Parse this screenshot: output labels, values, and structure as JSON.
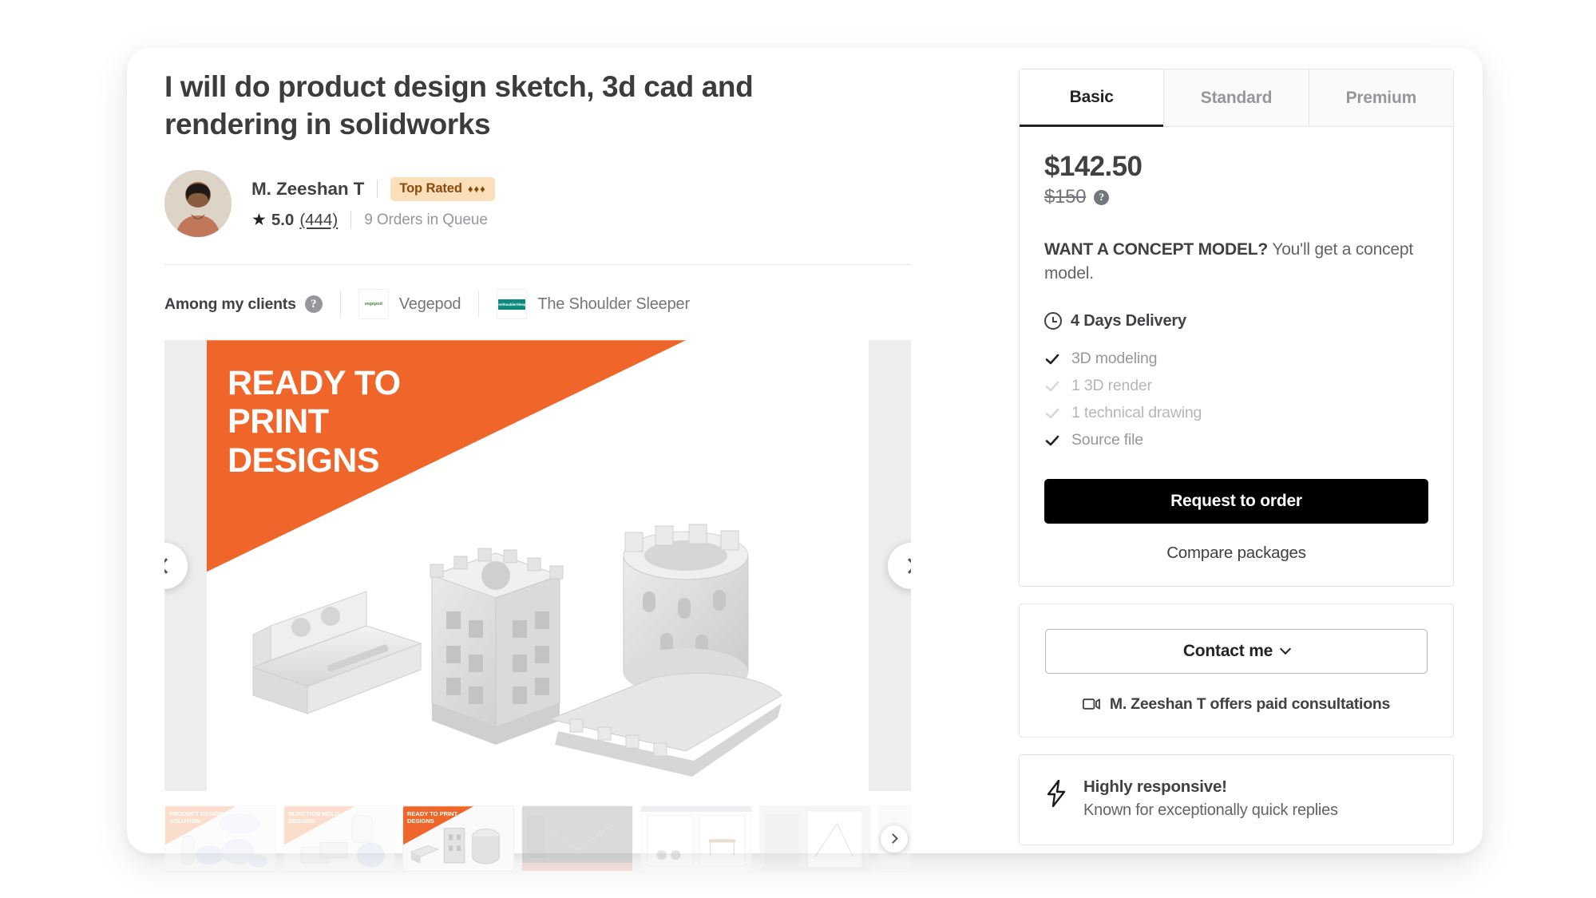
{
  "gig": {
    "title": "I will do product design sketch, 3d cad and rendering in solidworks"
  },
  "seller": {
    "name": "M. Zeeshan T",
    "badge_label": "Top Rated",
    "badge_diamonds": "♦♦♦",
    "rating_value": "5.0",
    "rating_count": "(444)",
    "queue": "9 Orders in Queue",
    "avatar_alt": "seller-avatar"
  },
  "clients": {
    "label": "Among my clients",
    "help_icon": "question-mark-icon",
    "items": [
      {
        "name": "Vegepod",
        "logo_text": "vegepod"
      },
      {
        "name": "The Shoulder Sleeper",
        "logo_text": "TheShoulderSleeper"
      }
    ]
  },
  "gallery": {
    "banner_line1": "READY TO",
    "banner_line2": "PRINT",
    "banner_line3": "DESIGNS",
    "banner_color": "#f0662a",
    "prev_label": "previous-slide",
    "next_label": "next-slide",
    "thumbs": [
      {
        "id": "t1",
        "line1": "PRODUCT DESIGN",
        "line2": "SOLUTION",
        "style": "peach",
        "active": false
      },
      {
        "id": "t2",
        "line1": "INJECTION MOLD",
        "line2": "DESIGNS",
        "style": "peach",
        "active": false
      },
      {
        "id": "t3",
        "line1": "READY TO PRINT",
        "line2": "DESIGNS",
        "style": "orange",
        "active": true
      },
      {
        "id": "t4",
        "line1": "",
        "line2": "",
        "style": "dark",
        "active": false
      },
      {
        "id": "t5",
        "line1": "",
        "line2": "",
        "style": "doc",
        "active": false
      },
      {
        "id": "t6",
        "line1": "",
        "line2": "",
        "style": "doc",
        "active": false
      },
      {
        "id": "t7",
        "line1": "",
        "line2": "",
        "style": "doc",
        "active": false
      }
    ],
    "thumb_next_label": "next-thumbnails"
  },
  "package": {
    "tabs": [
      {
        "label": "Basic",
        "active": true
      },
      {
        "label": "Standard",
        "active": false
      },
      {
        "label": "Premium",
        "active": false
      }
    ],
    "price": "$142.50",
    "price_original": "$150",
    "price_info_icon": "question-mark-icon",
    "desc_lead": "WANT A CONCEPT MODEL?",
    "desc_rest": " You'll get a concept model.",
    "delivery": "4 Days Delivery",
    "features": [
      {
        "label": "3D modeling",
        "included": true
      },
      {
        "label": "1 3D render",
        "included": false
      },
      {
        "label": "1 technical drawing",
        "included": false
      },
      {
        "label": "Source file",
        "included": true
      }
    ],
    "order_button": "Request to order",
    "compare_link": "Compare packages"
  },
  "contact": {
    "button_label": "Contact me",
    "chevron_icon": "chevron-down-icon",
    "consultation_text": "M. Zeeshan T offers paid consultations",
    "consultation_icon": "video-camera-icon"
  },
  "responsive": {
    "icon": "lightning-bolt-icon",
    "title": "Highly responsive!",
    "subtitle": "Known for exceptionally quick replies"
  }
}
